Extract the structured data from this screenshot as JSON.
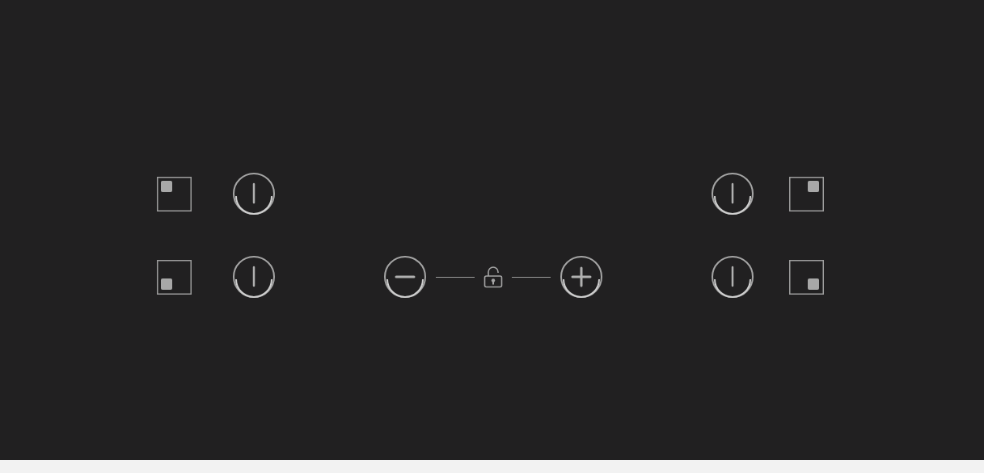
{
  "left_zones": [
    {
      "kind": "top-left"
    },
    {
      "kind": "bottom-left"
    }
  ],
  "right_zones": [
    {
      "kind": "top-right"
    },
    {
      "kind": "bottom-right"
    }
  ],
  "lock": {
    "locked": false
  }
}
